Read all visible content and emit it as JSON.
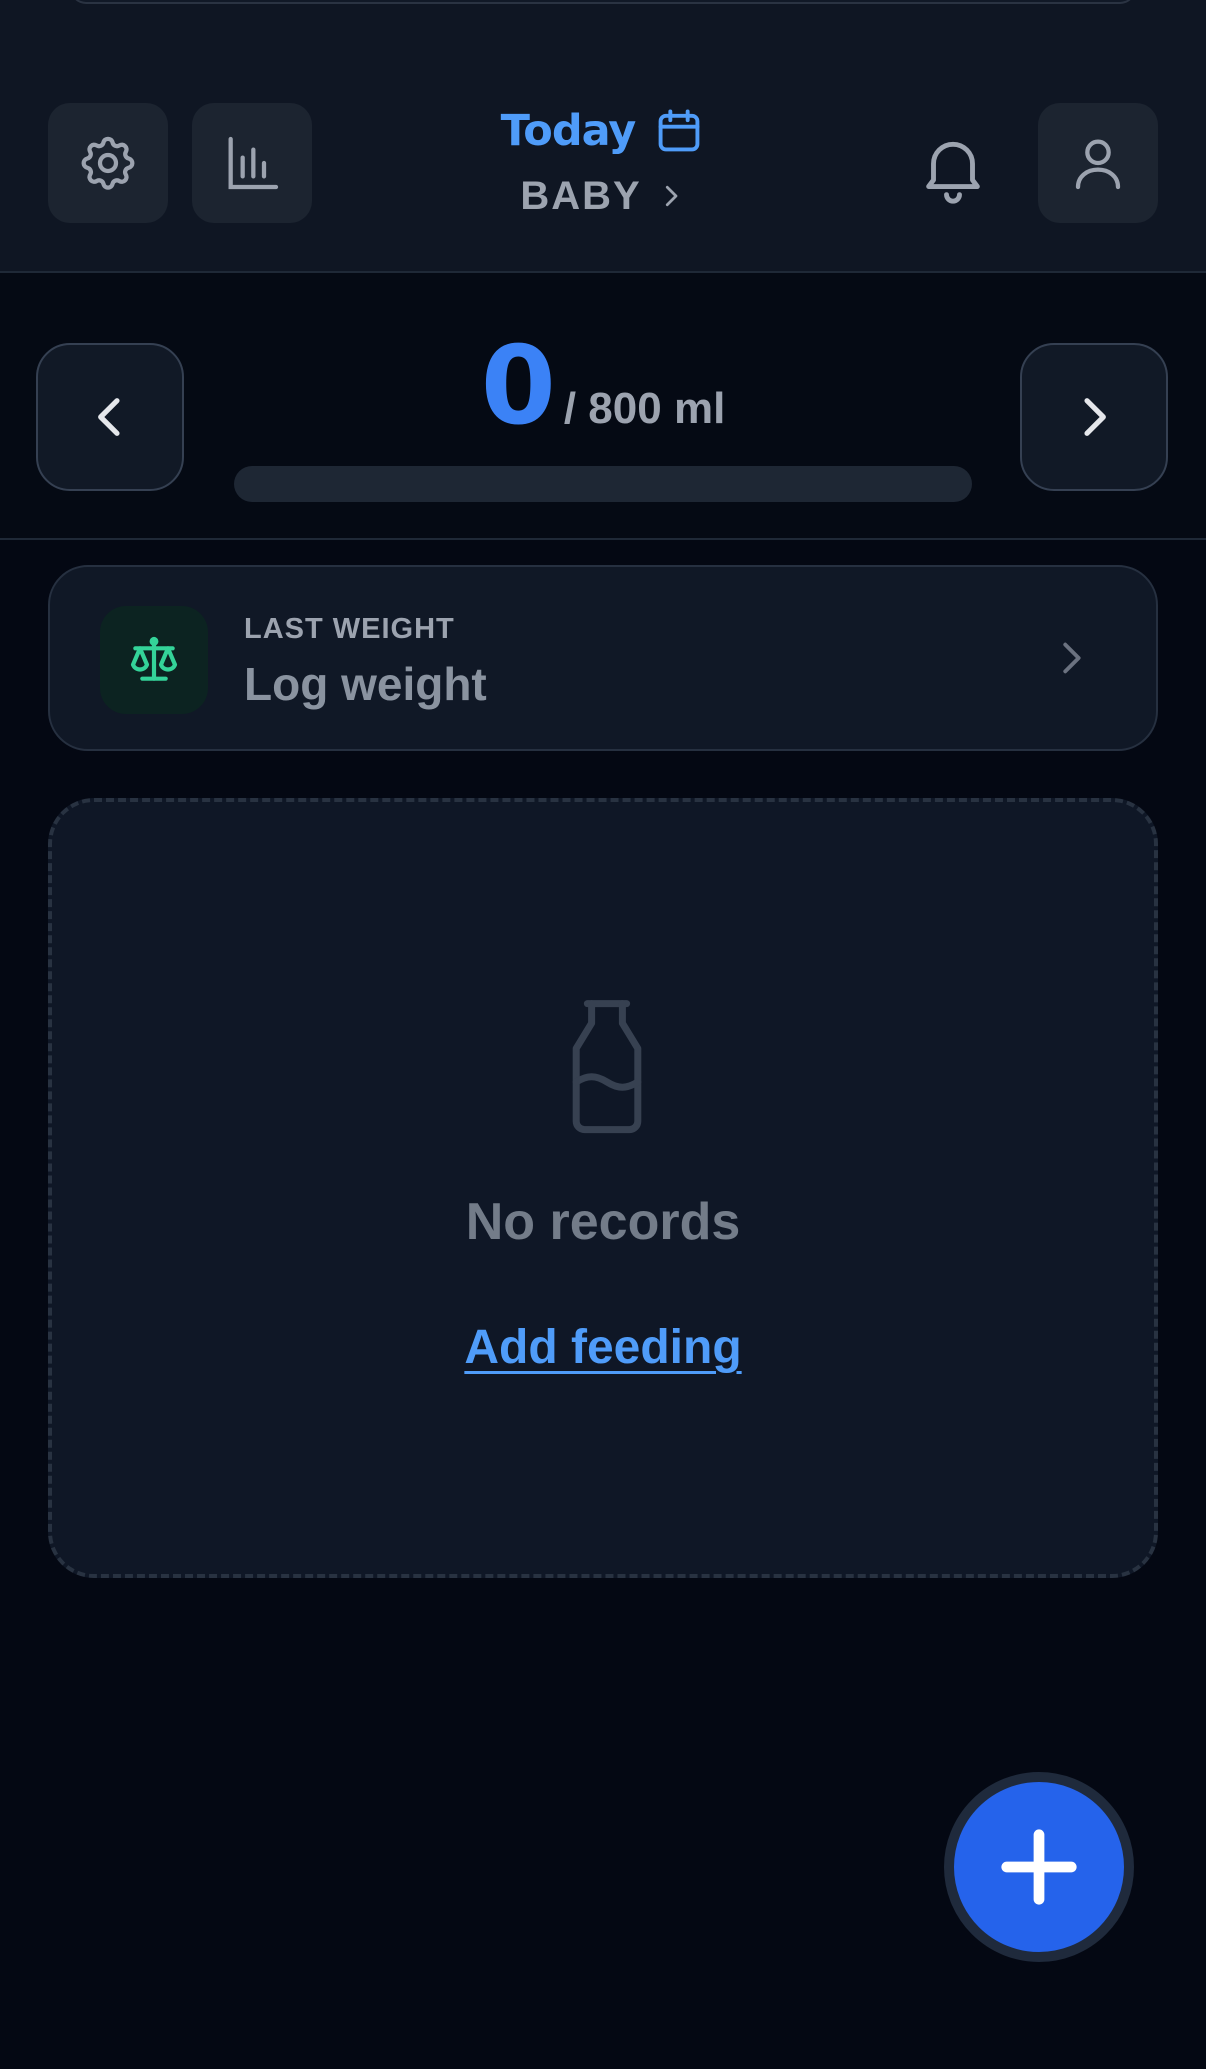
{
  "header": {
    "title": "Today",
    "subtitle": "BABY"
  },
  "summary": {
    "consumed": "0",
    "target_label": "/ 800 ml",
    "progress_fraction": 0
  },
  "weight_card": {
    "caption": "LAST WEIGHT",
    "action": "Log weight"
  },
  "empty_state": {
    "title": "No records",
    "link": "Add feeding"
  },
  "icons": {
    "settings": "gear-icon",
    "stats": "bar-chart-icon",
    "calendar": "calendar-icon",
    "chevron": "chevron-right-icon",
    "notifications": "bell-icon",
    "profile": "user-icon",
    "prev": "chevron-left-icon",
    "next": "chevron-right-icon",
    "weight": "scale-icon",
    "bottle": "bottle-icon",
    "add": "plus-icon"
  },
  "colors": {
    "accent": "#3b82f6",
    "accent_light": "#4f9cf9",
    "weight_icon": "#34d399",
    "background": "#040813"
  }
}
